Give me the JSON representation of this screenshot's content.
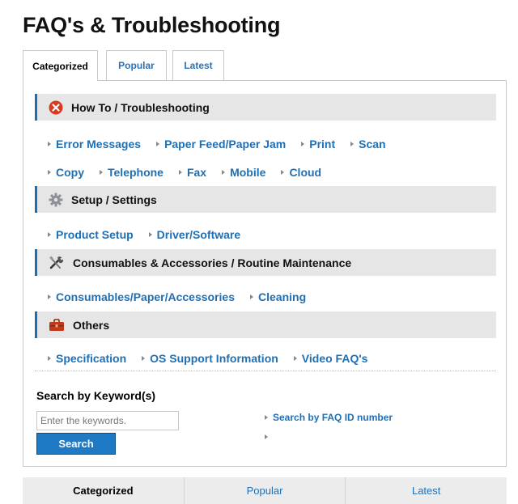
{
  "page": {
    "title": "FAQ's & Troubleshooting"
  },
  "tabs": [
    {
      "label": "Categorized",
      "active": true
    },
    {
      "label": "Popular",
      "active": false
    },
    {
      "label": "Latest",
      "active": false
    }
  ],
  "sections": [
    {
      "title": "How To / Troubleshooting",
      "icon": "error-icon",
      "rows": [
        [
          "Error Messages",
          "Paper Feed/Paper Jam",
          "Print",
          "Scan"
        ],
        [
          "Copy",
          "Telephone",
          "Fax",
          "Mobile",
          "Cloud"
        ]
      ]
    },
    {
      "title": "Setup / Settings",
      "icon": "gear-icon",
      "rows": [
        [
          "Product Setup",
          "Driver/Software"
        ]
      ]
    },
    {
      "title": "Consumables & Accessories / Routine Maintenance",
      "icon": "tools-icon",
      "rows": [
        [
          "Consumables/Paper/Accessories",
          "Cleaning"
        ]
      ]
    },
    {
      "title": "Others",
      "icon": "toolbox-icon",
      "rows": [
        [
          "Specification",
          "OS Support Information",
          "Video FAQ's"
        ]
      ]
    }
  ],
  "search": {
    "heading": "Search by Keyword(s)",
    "placeholder": "Enter the keywords.",
    "button_label": "Search",
    "faq_id_link": "Search by FAQ ID number"
  },
  "bottom_tabs": [
    {
      "label": "Categorized",
      "active": true
    },
    {
      "label": "Popular",
      "active": false
    },
    {
      "label": "Latest",
      "active": false
    }
  ],
  "colors": {
    "accent": "#1f6fb4",
    "button": "#1e7ac5",
    "section_bg": "#e6e6e6",
    "error_red": "#d9391f",
    "toolbox_red": "#c0391a"
  }
}
